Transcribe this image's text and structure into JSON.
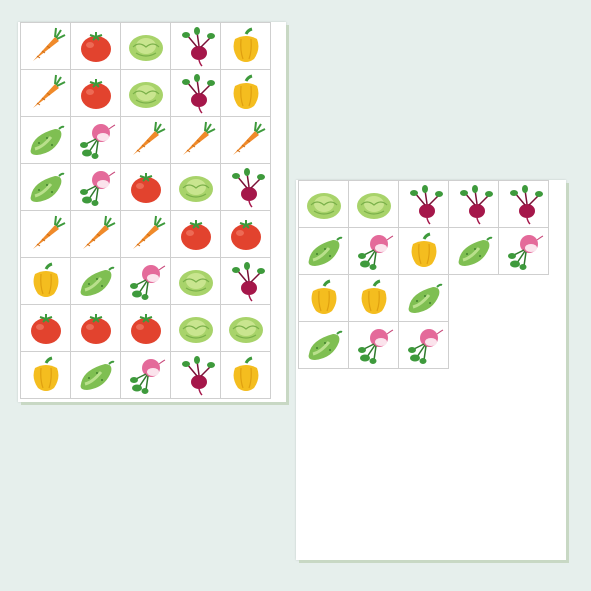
{
  "colors": {
    "background": "#e6efec",
    "carrot": "#f08a2a",
    "tomato": "#e2432e",
    "cabbage": "#a8d36a",
    "beet": "#a5174a",
    "pepper": "#f4bd1f",
    "cucumber": "#7fbf52",
    "radish": "#e46a9a",
    "leaf": "#3e9a3c"
  },
  "left_sheet": {
    "columns": 5,
    "cells": [
      "carrot-icon",
      "tomato-icon",
      "cabbage-icon",
      "beet-icon",
      "pepper-icon",
      "carrot-icon",
      "tomato-icon",
      "cabbage-icon",
      "beet-icon",
      "pepper-icon",
      "cucumber-icon",
      "radish-icon",
      "carrot-icon",
      "carrot-icon",
      "carrot-icon",
      "cucumber-icon",
      "radish-icon",
      "tomato-icon",
      "cabbage-icon",
      "beet-icon",
      "carrot-icon",
      "carrot-icon",
      "carrot-icon",
      "tomato-icon",
      "tomato-icon",
      "pepper-icon",
      "cucumber-icon",
      "radish-icon",
      "cabbage-icon",
      "beet-icon",
      "tomato-icon",
      "tomato-icon",
      "tomato-icon",
      "cabbage-icon",
      "cabbage-icon",
      "pepper-icon",
      "cucumber-icon",
      "radish-icon",
      "beet-icon",
      "pepper-icon"
    ]
  },
  "right_sheet": {
    "columns": 5,
    "cells": [
      "cabbage-icon",
      "cabbage-icon",
      "beet-icon",
      "beet-icon",
      "beet-icon",
      "cucumber-icon",
      "radish-icon",
      "pepper-icon",
      "cucumber-icon",
      "radish-icon",
      "pepper-icon",
      "pepper-icon",
      "cucumber-icon",
      "",
      "",
      "cucumber-icon",
      "radish-icon",
      "radish-icon",
      "",
      ""
    ]
  }
}
